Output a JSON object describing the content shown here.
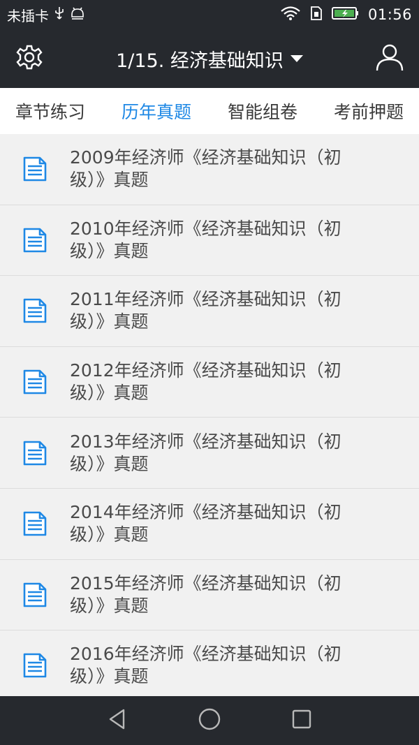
{
  "status_bar": {
    "carrier": "未插卡",
    "time": "01:56",
    "icons": [
      "usb-icon",
      "android-debug-icon",
      "wifi-icon",
      "sim-icon",
      "battery-charging-icon"
    ]
  },
  "app_bar": {
    "title": "1/15. 经济基础知识",
    "left_icon": "gear-icon",
    "right_icon": "user-icon"
  },
  "tabs": {
    "items": [
      {
        "label": "章节练习",
        "active": false
      },
      {
        "label": "历年真题",
        "active": true
      },
      {
        "label": "智能组卷",
        "active": false
      },
      {
        "label": "考前押题",
        "active": false
      }
    ],
    "active_color": "#1e88e5"
  },
  "papers": {
    "icon": "document-icon",
    "items": [
      {
        "title": "2009年经济师《经济基础知识（初级）》真题"
      },
      {
        "title": "2010年经济师《经济基础知识（初级）》真题"
      },
      {
        "title": "2011年经济师《经济基础知识（初级）》真题"
      },
      {
        "title": "2012年经济师《经济基础知识（初级）》真题"
      },
      {
        "title": "2013年经济师《经济基础知识（初级）》真题"
      },
      {
        "title": "2014年经济师《经济基础知识（初级）》真题"
      },
      {
        "title": "2015年经济师《经济基础知识（初级）》真题"
      },
      {
        "title": "2016年经济师《经济基础知识（初级）》真题"
      }
    ]
  },
  "nav_bar": {
    "icons": [
      "back-icon",
      "home-icon",
      "recents-icon"
    ]
  },
  "colors": {
    "header_bg": "#26292e",
    "accent": "#1e88e5",
    "list_bg": "#f1f1f1"
  }
}
